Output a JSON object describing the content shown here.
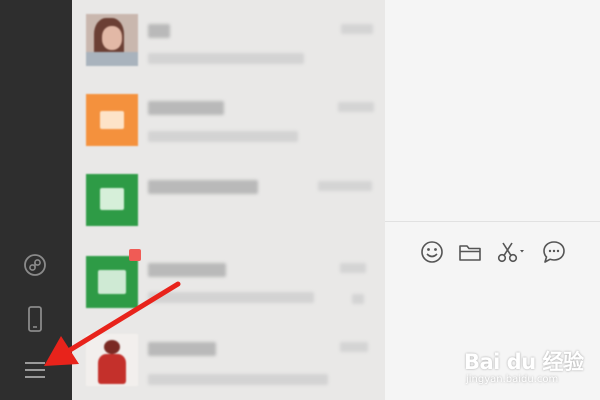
{
  "colors": {
    "sidebar_bg": "#2e2e2e",
    "chat_list_bg": "#e9e8e7",
    "main_bg": "#f5f5f5",
    "annotation_arrow": "#e8231b",
    "unread_badge": "#f05b55"
  },
  "sidebar": {
    "items": [
      {
        "icon": "mini-program-icon"
      },
      {
        "icon": "phone-icon"
      },
      {
        "icon": "menu-icon"
      }
    ]
  },
  "chat_list": {
    "items": [
      {
        "avatar": "photo",
        "unread": false
      },
      {
        "avatar": "orange",
        "unread": false
      },
      {
        "avatar": "green",
        "unread": false
      },
      {
        "avatar": "green",
        "unread": true
      },
      {
        "avatar": "photo",
        "unread": false
      }
    ]
  },
  "toolbar": {
    "icons": [
      "emoji-icon",
      "folder-icon",
      "scissors-icon",
      "chat-bubble-icon"
    ]
  },
  "watermark": {
    "brand": "Bai du 经验",
    "sub": "jingyan.baidu.com"
  }
}
